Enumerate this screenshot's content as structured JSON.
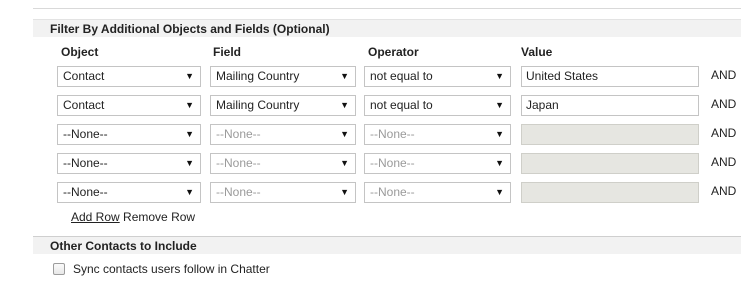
{
  "filter_section": {
    "title": "Filter By Additional Objects and Fields (Optional)",
    "columns": {
      "object": "Object",
      "field": "Field",
      "operator": "Operator",
      "value": "Value"
    },
    "rows": [
      {
        "object": "Contact",
        "field": "Mailing Country",
        "operator": "not equal to",
        "value": "United States",
        "logic": "AND",
        "enabled": true
      },
      {
        "object": "Contact",
        "field": "Mailing Country",
        "operator": "not equal to",
        "value": "Japan",
        "logic": "AND",
        "enabled": true
      },
      {
        "object": "--None--",
        "field": "--None--",
        "operator": "--None--",
        "value": "",
        "logic": "AND",
        "enabled": false
      },
      {
        "object": "--None--",
        "field": "--None--",
        "operator": "--None--",
        "value": "",
        "logic": "AND",
        "enabled": false
      },
      {
        "object": "--None--",
        "field": "--None--",
        "operator": "--None--",
        "value": "",
        "logic": "AND",
        "enabled": false
      }
    ],
    "add_row": "Add Row",
    "remove_row": "Remove Row"
  },
  "other_section": {
    "title": "Other Contacts to Include",
    "sync_label": "Sync contacts users follow in Chatter",
    "sync_checked": false
  },
  "icons": {
    "dropdown_arrow": "▼"
  }
}
